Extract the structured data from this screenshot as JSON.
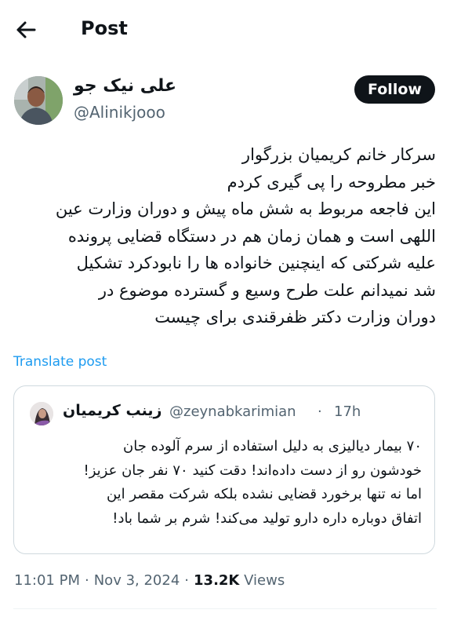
{
  "header": {
    "title": "Post",
    "back_icon": "arrow-left-icon"
  },
  "author": {
    "name": "علی نیک جو",
    "handle": "@Alinikjooo",
    "follow_label": "Follow"
  },
  "post": {
    "text": "سرکار خانم کریمیان بزرگوار\nخبر مطروحه را پی گیری کردم\nاین فاجعه مربوط به شش ماه پیش و دوران وزارت عین\nاللهی است و همان زمان هم در دستگاه قضایی پرونده\nعلیه شرکتی که اینچنین خانواده ها را نابودکرد تشکیل\nشد نمیدانم علت طرح وسیع و گسترده  موضوع در\nدوران وزارت دکتر ظفرقندی برای چیست",
    "translate_label": "Translate post"
  },
  "quote": {
    "name": "زینب کریمیان",
    "handle": "@zeynabkarimian",
    "dot": "·",
    "time": "17h",
    "text": "۷۰ بیمار دیالیزی به دلیل استفاده از سرم آلوده جان\nخودشون رو از دست داده‌اند! دقت کنید ۷۰ نفر جان عزیز!\nاما نه تنها برخورد قضایی نشده بلکه شرکت مقصر این\nاتفاق دوباره داره دارو تولید می‌کند! شرم بر شما باد!"
  },
  "meta": {
    "time": "11:01 PM",
    "sep1": "·",
    "date": "Nov 3, 2024",
    "sep2": "·",
    "views_count": "13.2K",
    "views_label": "Views"
  },
  "colors": {
    "link": "#1d9bf0",
    "secondary_text": "#536471",
    "border": "#cfd9de",
    "follow_bg": "#0f1419"
  }
}
